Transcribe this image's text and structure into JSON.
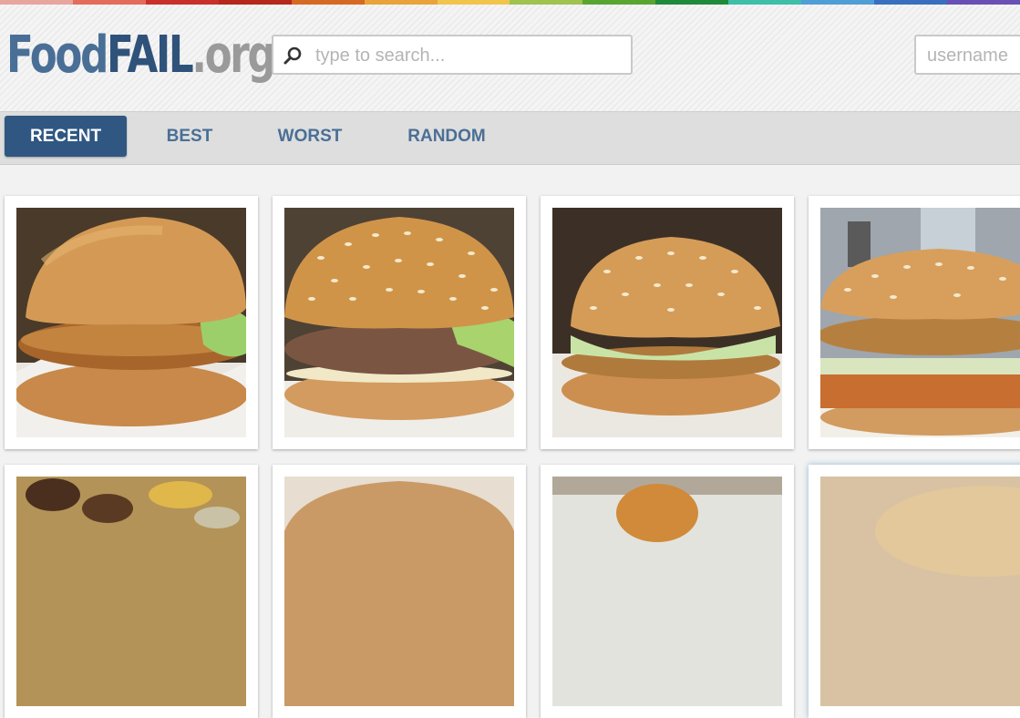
{
  "site": {
    "logo_food": "Food",
    "logo_fail": "FAIL",
    "logo_org": ".org"
  },
  "search": {
    "placeholder": "type to search..."
  },
  "login": {
    "username_placeholder": "username"
  },
  "nav": {
    "tabs": [
      "RECENT",
      "BEST",
      "WORST",
      "RANDOM"
    ],
    "active": "RECENT"
  },
  "colors": {
    "accent": "#2f5782",
    "link": "#4a6f96",
    "stripe": [
      "#e8a59d",
      "#e36c5c",
      "#c9302b",
      "#b5281c",
      "#d66a23",
      "#e8a33a",
      "#f1c54b",
      "#9ec34f",
      "#5aa532",
      "#1f8a3a",
      "#3dbfa8",
      "#4f9fd6",
      "#3a6fc0",
      "#6a4fb5"
    ]
  },
  "grid": {
    "items": [
      {
        "icon": "fried-chicken-sandwich-photo"
      },
      {
        "icon": "sesame-hamburger-photo"
      },
      {
        "icon": "sesame-chicken-burger-photo"
      },
      {
        "icon": "double-decker-burger-photo"
      },
      {
        "icon": "loaded-nachos-photo"
      },
      {
        "icon": "burger-bun-photo"
      },
      {
        "icon": "chicken-nugget-photo"
      },
      {
        "icon": "bun-closeup-photo"
      }
    ]
  }
}
